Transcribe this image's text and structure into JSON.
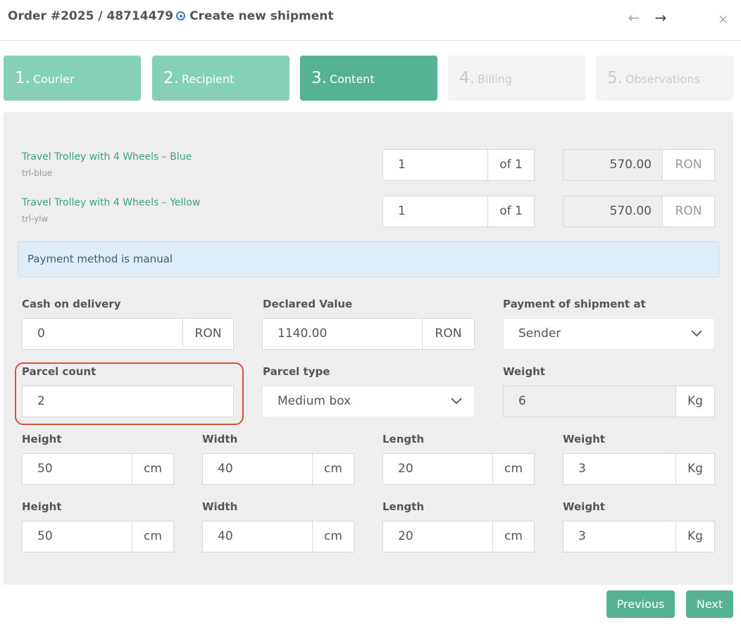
{
  "header": {
    "order": "Order #2025 / 48714479",
    "title": "Create new shipment",
    "prev_icon": "arrow-left-icon",
    "next_icon": "arrow-right-icon",
    "close_icon": "close-icon",
    "prev_glyph": "←",
    "next_glyph": "→",
    "close_glyph": "×"
  },
  "steps": [
    {
      "num": "1.",
      "label": "Courier",
      "state": "done"
    },
    {
      "num": "2.",
      "label": "Recipient",
      "state": "done"
    },
    {
      "num": "3.",
      "label": "Content",
      "state": "active"
    },
    {
      "num": "4.",
      "label": "Billing",
      "state": "disabled"
    },
    {
      "num": "5.",
      "label": "Observations",
      "state": "disabled"
    }
  ],
  "products": [
    {
      "name": "Travel Trolley with 4 Wheels – Blue",
      "sku": "trl-blue",
      "qty": "1",
      "of": "of 1",
      "price": "570.00",
      "currency": "RON"
    },
    {
      "name": "Travel Trolley with 4 Wheels – Yellow",
      "sku": "trl-ylw",
      "qty": "1",
      "of": "of 1",
      "price": "570.00",
      "currency": "RON"
    }
  ],
  "alert": "Payment method is manual",
  "cod": {
    "label": "Cash on delivery",
    "value": "0",
    "unit": "RON"
  },
  "declared": {
    "label": "Declared Value",
    "value": "1140.00",
    "unit": "RON"
  },
  "payment": {
    "label": "Payment of shipment at",
    "value": "Sender"
  },
  "parcel_count": {
    "label": "Parcel count",
    "value": "2"
  },
  "parcel_type": {
    "label": "Parcel type",
    "value": "Medium box"
  },
  "weight_total": {
    "label": "Weight",
    "value": "6",
    "unit": "Kg"
  },
  "parcels": [
    {
      "height_label": "Height",
      "height": "50",
      "width_label": "Width",
      "width": "40",
      "length_label": "Length",
      "length": "20",
      "weight_label": "Weight",
      "weight": "3",
      "dim_unit": "cm",
      "weight_unit": "Kg"
    },
    {
      "height_label": "Height",
      "height": "50",
      "width_label": "Width",
      "width": "40",
      "length_label": "Length",
      "length": "20",
      "weight_label": "Weight",
      "weight": "3",
      "dim_unit": "cm",
      "weight_unit": "Kg"
    }
  ],
  "buttons": {
    "previous": "Previous",
    "next": "Next"
  },
  "colors": {
    "accent": "#55b394",
    "accent_light": "#86cfb9",
    "highlight": "#d5533a",
    "link": "#3aa57b"
  }
}
